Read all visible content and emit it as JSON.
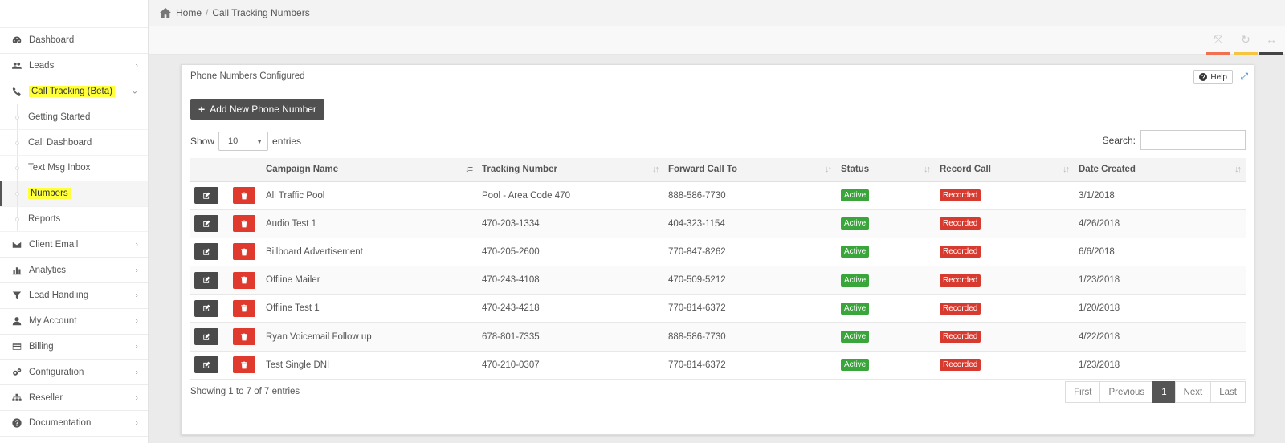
{
  "breadcrumb": {
    "home": "Home",
    "separator": "/",
    "current": "Call Tracking Numbers"
  },
  "sidebar": {
    "items": [
      {
        "label": "Dashboard",
        "icon": "dashboard-icon"
      },
      {
        "label": "Leads",
        "icon": "users-icon",
        "chevron": "›"
      },
      {
        "label": "Call Tracking (Beta)",
        "icon": "phone-icon",
        "chevron": "⌄",
        "highlight": "#ffff3a"
      },
      {
        "label": "Getting Started"
      },
      {
        "label": "Call Dashboard"
      },
      {
        "label": "Text Msg Inbox"
      },
      {
        "label": "Numbers",
        "highlight": "#ffff3a"
      },
      {
        "label": "Reports"
      },
      {
        "label": "Client Email",
        "icon": "envelope-icon",
        "chevron": "›"
      },
      {
        "label": "Analytics",
        "icon": "bar-chart-icon",
        "chevron": "›"
      },
      {
        "label": "Lead Handling",
        "icon": "filter-icon",
        "chevron": "›"
      },
      {
        "label": "My Account",
        "icon": "user-icon",
        "chevron": "›"
      },
      {
        "label": "Billing",
        "icon": "credit-card-icon",
        "chevron": "›"
      },
      {
        "label": "Configuration",
        "icon": "gears-icon",
        "chevron": "›"
      },
      {
        "label": "Reseller",
        "icon": "sitemap-icon",
        "chevron": "›"
      },
      {
        "label": "Documentation",
        "icon": "question-circle-icon",
        "chevron": "›"
      }
    ]
  },
  "toolbar": {
    "tools": [
      {
        "icon": "fullscreen-icon",
        "glyph": "⤧",
        "color": "#f07050"
      },
      {
        "icon": "refresh-icon",
        "glyph": "↻",
        "color": "#f5c542"
      },
      {
        "icon": "width-toggle-icon",
        "glyph": "↔",
        "color": "#444444"
      }
    ]
  },
  "panel": {
    "title": "Phone Numbers Configured",
    "help": "Help",
    "expand_icon": "⤢",
    "add_button": "Add New Phone Number",
    "show_label": "Show",
    "entries_value": "10",
    "entries_label": "entries",
    "search_label": "Search:",
    "search_value": "",
    "columns": [
      "Campaign Name",
      "Tracking Number",
      "Forward Call To",
      "Status",
      "Record Call",
      "Date Created"
    ],
    "rows": [
      {
        "campaign": "All Traffic Pool",
        "tracking": "Pool - Area Code 470",
        "forward": "888-586-7730",
        "status": "Active",
        "record": "Recorded",
        "date": "3/1/2018"
      },
      {
        "campaign": "Audio Test 1",
        "tracking": "470-203-1334",
        "forward": "404-323-1154",
        "status": "Active",
        "record": "Recorded",
        "date": "4/26/2018"
      },
      {
        "campaign": "Billboard Advertisement",
        "tracking": "470-205-2600",
        "forward": "770-847-8262",
        "status": "Active",
        "record": "Recorded",
        "date": "6/6/2018"
      },
      {
        "campaign": "Offline Mailer",
        "tracking": "470-243-4108",
        "forward": "470-509-5212",
        "status": "Active",
        "record": "Recorded",
        "date": "1/23/2018"
      },
      {
        "campaign": "Offline Test 1",
        "tracking": "470-243-4218",
        "forward": "770-814-6372",
        "status": "Active",
        "record": "Recorded",
        "date": "1/20/2018"
      },
      {
        "campaign": "Ryan Voicemail Follow up",
        "tracking": "678-801-7335",
        "forward": "888-586-7730",
        "status": "Active",
        "record": "Recorded",
        "date": "4/22/2018"
      },
      {
        "campaign": "Test Single DNI",
        "tracking": "470-210-0307",
        "forward": "770-814-6372",
        "status": "Active",
        "record": "Recorded",
        "date": "1/23/2018"
      }
    ],
    "info": "Showing 1 to 7 of 7 entries",
    "pager": {
      "first": "First",
      "previous": "Previous",
      "current": "1",
      "next": "Next",
      "last": "Last"
    }
  },
  "colors": {
    "edit_button": "#4a4a4a",
    "delete_button": "#e03a2f",
    "status_active": "#3aa53a",
    "recorded": "#d73a2f",
    "highlight": "#ffff3a"
  }
}
